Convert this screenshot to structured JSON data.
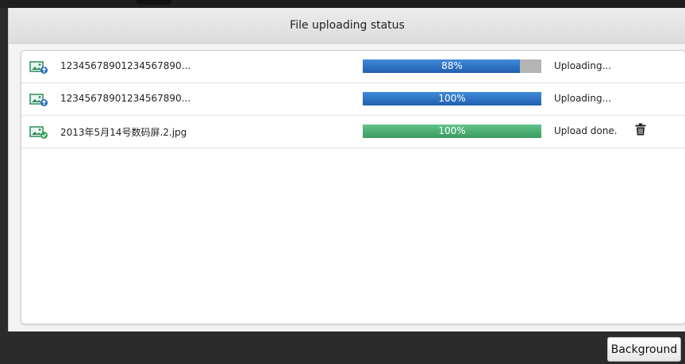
{
  "dialog": {
    "title": "File uploading status"
  },
  "files": [
    {
      "name": "12345678901234567890...",
      "progress": 0.88,
      "progress_label": "88%",
      "bar_color": "#2a6fc4",
      "status": "Uploading...",
      "state_icon": "upload-arrow-icon",
      "deletable": false
    },
    {
      "name": "12345678901234567890...",
      "progress": 1.0,
      "progress_label": "100%",
      "bar_color": "#2a6fc4",
      "status": "Uploading...",
      "state_icon": "upload-arrow-icon",
      "deletable": false
    },
    {
      "name": "2013年5月14号数码屏.2.jpg",
      "progress": 1.0,
      "progress_label": "100%",
      "bar_color": "#45a96e",
      "status": "Upload done.",
      "state_icon": "check-icon",
      "deletable": true
    }
  ],
  "footer": {
    "background_button": "Background"
  }
}
